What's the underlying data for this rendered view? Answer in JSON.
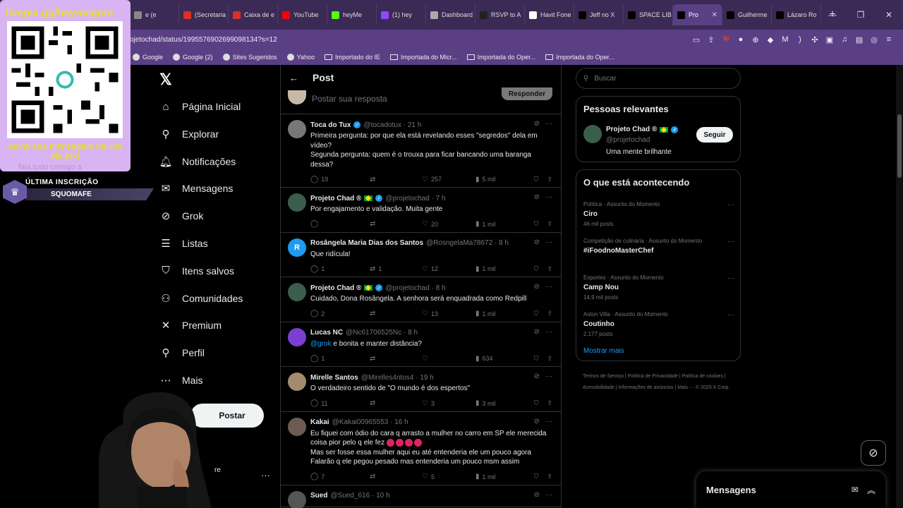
{
  "browser": {
    "tabs": [
      {
        "label": "e (e",
        "color": "#888"
      },
      {
        "label": "(Secretaria",
        "color": "#d93025"
      },
      {
        "label": "Caixa de e",
        "color": "#d93025"
      },
      {
        "label": "YouTube",
        "color": "#ff0000"
      },
      {
        "label": "heyMe",
        "color": "#53fc18"
      },
      {
        "label": "(1) hey",
        "color": "#9147ff"
      },
      {
        "label": "Dashboard",
        "color": "#aaa"
      },
      {
        "label": "RSVP to A",
        "color": "#222"
      },
      {
        "label": "Havit Fone",
        "color": "#fff"
      },
      {
        "label": "Jeff no X",
        "color": "#000"
      },
      {
        "label": "SPACE LIB",
        "color": "#000"
      },
      {
        "label": "Pro",
        "color": "#000",
        "active": true
      },
      {
        "label": "Guilherme",
        "color": "#000"
      },
      {
        "label": "Lázaro Ro",
        "color": "#000"
      }
    ],
    "url": "ojetochad/status/1995576902699098134?s=12",
    "bookmarks": [
      "Google",
      "Google (2)",
      "Sites Sugeridos",
      "Yahoo",
      "Importado do IE",
      "Importada do Micr...",
      "Importada do Oper...",
      "Importada do Oper..."
    ]
  },
  "nav": {
    "items": [
      {
        "label": "Página Inicial",
        "icon": "home-icon",
        "glyph": "⌂"
      },
      {
        "label": "Explorar",
        "icon": "search-icon",
        "glyph": "⚲"
      },
      {
        "label": "Notificações",
        "icon": "bell-icon",
        "glyph": "🔔︎"
      },
      {
        "label": "Mensagens",
        "icon": "mail-icon",
        "glyph": "✉"
      },
      {
        "label": "Grok",
        "icon": "grok-icon",
        "glyph": "⊘"
      },
      {
        "label": "Listas",
        "icon": "list-icon",
        "glyph": "☰"
      },
      {
        "label": "Itens salvos",
        "icon": "bookmark-icon",
        "glyph": "⛉"
      },
      {
        "label": "Comunidades",
        "icon": "communities-icon",
        "glyph": "⚇"
      },
      {
        "label": "Premium",
        "icon": "x-icon",
        "glyph": "✕"
      },
      {
        "label": "Perfil",
        "icon": "profile-icon",
        "glyph": "⚲"
      },
      {
        "label": "Mais",
        "icon": "more-icon",
        "glyph": "⋯"
      }
    ],
    "post_label": "Postar",
    "user_stub": "re",
    "user_dots": "···"
  },
  "post": {
    "title": "Post",
    "reply_placeholder": "Postar sua resposta",
    "reply_button": "Responder"
  },
  "tweets": [
    {
      "name": "Toca do Tux",
      "verified": true,
      "flag": false,
      "handle": "@tocadotux · 21 h",
      "avatar_color": "#777",
      "avatar_letter": "",
      "text": [
        "Primeira pergunta: por que ela está revelando esses \"segredos\" dela em vídeo?",
        "Segunda pergunta: quem é o trouxa para ficar bancando uma baranga dessa?"
      ],
      "replies": "19",
      "reposts": "",
      "likes": "257",
      "views": "5 mil"
    },
    {
      "name": "Projeto Chad ®",
      "verified": true,
      "flag": true,
      "handle": "@projetochad · 7 h",
      "avatar_color": "#3b5e4c",
      "avatar_letter": "",
      "text": [
        "Por engajamento e validação. Muita gente"
      ],
      "replies": "",
      "reposts": "",
      "likes": "20",
      "views": "1 mil"
    },
    {
      "name": "Rosângela Maria Dias dos Santos",
      "verified": false,
      "flag": false,
      "handle": "@RosngelaMa78672 · 8 h",
      "avatar_color": "#1d9bf0",
      "avatar_letter": "R",
      "text": [
        "Que ridícula!"
      ],
      "replies": "1",
      "reposts": "1",
      "likes": "12",
      "views": "1 mil"
    },
    {
      "name": "Projeto Chad ®",
      "verified": true,
      "flag": true,
      "handle": "@projetochad · 8 h",
      "avatar_color": "#3b5e4c",
      "avatar_letter": "",
      "text": [
        "Cuidado, Dona Rosângela. A senhora será enquadrada como Redpill"
      ],
      "replies": "2",
      "reposts": "",
      "likes": "13",
      "views": "1 mil"
    },
    {
      "name": "Lucas NC",
      "verified": false,
      "flag": false,
      "handle": "@Nc61706525Nc · 8 h",
      "avatar_color": "#7a3fd1",
      "avatar_letter": "",
      "mention": "@grok",
      "text": [
        " e bonita e manter distância?"
      ],
      "replies": "1",
      "reposts": "",
      "likes": "",
      "views": "634"
    },
    {
      "name": "Mirelle Santos",
      "verified": false,
      "flag": false,
      "handle": "@Mirelles4ntos4 · 19 h",
      "avatar_color": "#a58b6e",
      "avatar_letter": "",
      "text": [
        "O verdadeiro sentido de \"O mundo é dos espertos\""
      ],
      "replies": "11",
      "reposts": "",
      "likes": "3",
      "views": "3 mil"
    },
    {
      "name": "Kakai",
      "verified": false,
      "flag": false,
      "handle": "@Kakai00965553 · 16 h",
      "avatar_color": "#6d5b52",
      "avatar_letter": "",
      "text": [
        "Eu fiquei com ódio do cara q arrasto a mulher no carro em SP ele merecida coisa pior pelo q ele fez",
        "Mas ser fosse essa mulher  aqui eu até entenderia ele um pouco agora",
        "Falarão q ele pegou pesado mas entenderia um pouco msm assim"
      ],
      "emoji_count": 4,
      "replies": "7",
      "reposts": "",
      "likes": "5",
      "views": "1 mil"
    },
    {
      "name": "Sued",
      "verified": false,
      "flag": false,
      "handle": "@Sued_616 · 10 h",
      "avatar_color": "#555",
      "avatar_letter": "",
      "text": [],
      "replies": "",
      "reposts": "",
      "likes": "",
      "views": ""
    }
  ],
  "right": {
    "search_placeholder": "Buscar",
    "relevant": {
      "title": "Pessoas relevantes",
      "name": "Projeto Chad ®",
      "handle": "@projetochad",
      "bio": "Uma mente brilhante",
      "follow": "Seguir"
    },
    "trends_title": "O que está acontecendo",
    "trends": [
      {
        "meta": "Política · Assunto do Momento",
        "name": "Ciro",
        "count": "46 mil posts"
      },
      {
        "meta": "Competição de culinária · Assunto do Momento",
        "name": "#iFoodnoMasterChef",
        "count": ""
      },
      {
        "meta": "Esportes · Assunto do Momento",
        "name": "Camp Nou",
        "count": "14,9 mil posts"
      },
      {
        "meta": "Aston Villa · Assunto do Momento",
        "name": "Coutinho",
        "count": "2.177 posts"
      }
    ],
    "show_more": "Mostrar mais",
    "footer": "Termos de Serviço  |  Política de Privacidade  |  Política de cookies  |  Acessibilidade  |  Informações de anúncios  |  Mais ···  © 2025 X Corp."
  },
  "messages_dock": {
    "title": "Mensagens"
  },
  "overlay": {
    "url": "livepix.gg/heymegera",
    "cta": "envie sua mensagem na live via pix!",
    "faint": "fala tudo comigo a",
    "sub_label": "ÚLTIMA INSCRIÇÃO",
    "sub_name": "SQUOMAFE"
  }
}
